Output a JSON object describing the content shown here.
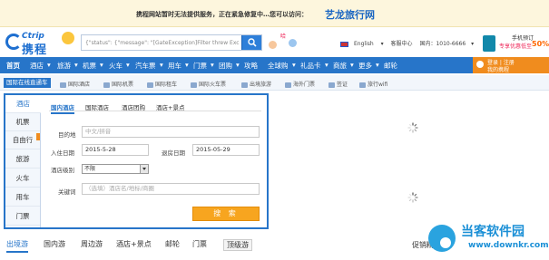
{
  "banner": {
    "message": "携程网站暂时无法提供服务，正在紧急修复中…您可以访问：",
    "brand_link": "艺龙旅行网"
  },
  "header": {
    "logo_en": "Ctrip",
    "logo_cn": "携程",
    "search_value": "{\"status\": {\"message\": \"[GateException]Filter threw Excep",
    "mascot_text": "哈",
    "language": "English",
    "service_center": "客服中心",
    "domestic_phone": "国内：1010-6666",
    "app": {
      "line1": "手机预订",
      "line2": "专享优惠低至",
      "percent": "50%"
    }
  },
  "nav": {
    "items": [
      "首页",
      "酒店",
      "旅游",
      "机票",
      "火车",
      "汽车票",
      "用车",
      "门票",
      "团购",
      "攻略",
      "全球购",
      "礼品卡",
      "商旅",
      "更多",
      "邮轮"
    ],
    "user_login": "登录 | 注册",
    "user_my": "我的携程"
  },
  "subnav": {
    "current": "国际在线直通车",
    "items": [
      "国际酒店",
      "国际机票",
      "国际租车",
      "国际火车票",
      "出境旅游",
      "海外门票",
      "签证",
      "旅行wifi"
    ]
  },
  "side_menu": [
    "酒店",
    "机票",
    "自由行",
    "旅游",
    "火车",
    "用车",
    "门票"
  ],
  "tabs": [
    "国内酒店",
    "国际酒店",
    "酒店团购",
    "酒店+景点"
  ],
  "form": {
    "destination_label": "目的地",
    "destination_placeholder": "中文/拼音",
    "checkin_label": "入住日期",
    "checkin_value": "2015-5-28",
    "checkout_label": "退房日期",
    "checkout_value": "2015-05-29",
    "star_label": "酒店级别",
    "star_value": "不限",
    "keyword_label": "关键词",
    "keyword_placeholder": "（选填）酒店名/地标/商圈",
    "submit": "搜 索"
  },
  "bottom_tabs": [
    "出境游",
    "国内游",
    "周边游",
    "酒店+景点",
    "邮轮",
    "门票",
    "顶级游"
  ],
  "bottom_right": "促销精",
  "watermark": {
    "name": "当客软件园",
    "url": "www.downkr.com"
  },
  "colors": {
    "nav_blue": "#2775c9",
    "accent_orange": "#f7a51f",
    "banner_bg": "#fdf6dd"
  }
}
